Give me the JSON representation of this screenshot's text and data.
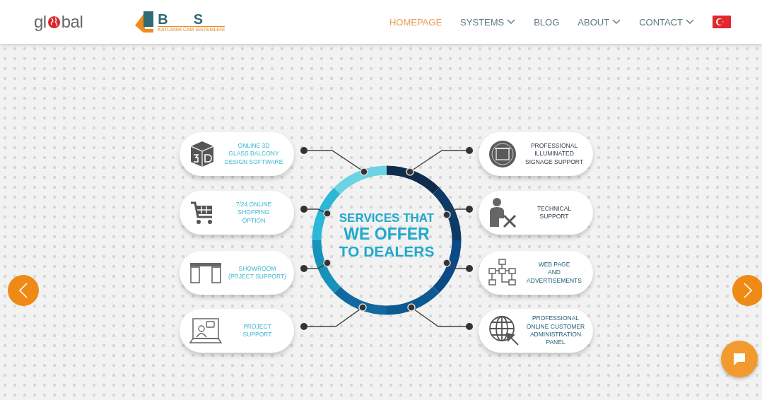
{
  "header": {
    "logo_global": {
      "before": "gl",
      "after": "bal"
    },
    "logo_bs": {
      "letters": [
        "B",
        "S"
      ],
      "tagline": "KATLANIR CAM SİSTEMLERİ"
    },
    "nav": [
      {
        "label": "HOMEPAGE",
        "selected": true,
        "dropdown": false
      },
      {
        "label": "SYSTEMS",
        "selected": false,
        "dropdown": true
      },
      {
        "label": "BLOG",
        "selected": false,
        "dropdown": false
      },
      {
        "label": "ABOUT",
        "selected": false,
        "dropdown": true
      },
      {
        "label": "CONTACT",
        "selected": false,
        "dropdown": true
      }
    ]
  },
  "slide": {
    "title": [
      "SERVICES THAT",
      "WE OFFER",
      "TO DEALERS"
    ],
    "left_services": [
      {
        "lines": [
          "ONLINE 3D",
          "GLASS BALCONY",
          "DESIGN SOFTWARE"
        ]
      },
      {
        "lines": [
          "7/24 ONLINE",
          "SHOPPING",
          "OPTION"
        ]
      },
      {
        "lines": [
          "SHOWROOM",
          "(PRJECT SUPPORT)"
        ]
      },
      {
        "lines": [
          "PROJECT",
          "SUPPORT"
        ]
      }
    ],
    "right_services": [
      {
        "lines": [
          "PROFESSIONAL",
          "ILLUMINATED",
          "SIGNAGE SUPPORT"
        ]
      },
      {
        "lines": [
          "TECHNICAL",
          "SUPPORT"
        ]
      },
      {
        "lines": [
          "WEB PAGE",
          "AND",
          "ADVERTISEMENTS"
        ]
      },
      {
        "lines": [
          "PROFESSIONAL",
          "ONLINE CUSTOMER",
          "ADMINISTRATION",
          "PANEL"
        ]
      }
    ]
  }
}
